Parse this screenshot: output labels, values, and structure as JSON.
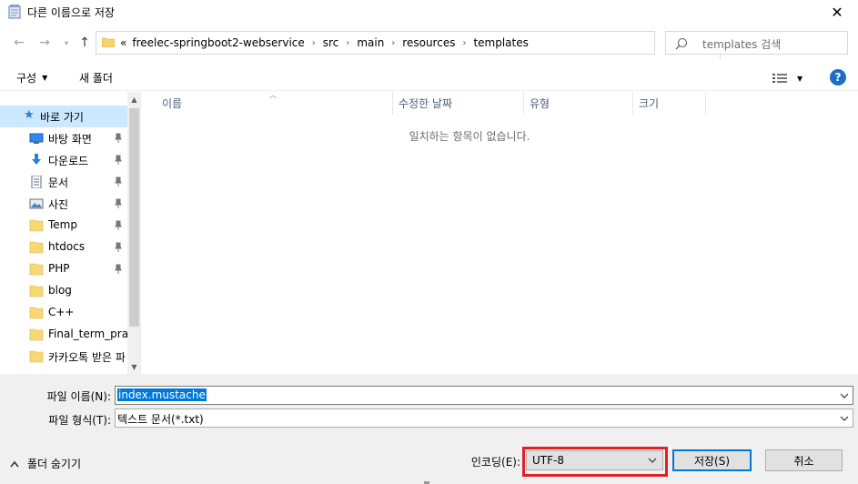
{
  "window": {
    "title": "다른 이름으로 저장"
  },
  "nav": {
    "back_icon": "arrow-left-icon",
    "forward_icon": "arrow-right-icon",
    "up_icon": "arrow-up-icon",
    "overflow": "«",
    "breadcrumbs": [
      "freelec-springboot2-webservice",
      "src",
      "main",
      "resources",
      "templates"
    ],
    "search_placeholder": "templates 검색"
  },
  "toolbar": {
    "organize": "구성",
    "new_folder": "새 폴더",
    "help": "?"
  },
  "sidebar": {
    "quick_access": "바로 가기",
    "items": [
      {
        "label": "바탕 화면",
        "icon": "desktop-icon",
        "pinned": true
      },
      {
        "label": "다운로드",
        "icon": "download-icon",
        "pinned": true
      },
      {
        "label": "문서",
        "icon": "document-icon",
        "pinned": true
      },
      {
        "label": "사진",
        "icon": "pictures-icon",
        "pinned": true
      },
      {
        "label": "Temp",
        "icon": "folder-icon",
        "pinned": true
      },
      {
        "label": "htdocs",
        "icon": "folder-icon",
        "pinned": true
      },
      {
        "label": "PHP",
        "icon": "folder-icon",
        "pinned": true
      },
      {
        "label": "blog",
        "icon": "folder-icon",
        "pinned": false
      },
      {
        "label": "C++",
        "icon": "folder-icon",
        "pinned": false
      },
      {
        "label": "Final_term_pract",
        "icon": "folder-icon",
        "pinned": false
      },
      {
        "label": "카카오톡 받은 파",
        "icon": "folder-icon",
        "pinned": false
      }
    ]
  },
  "filelist": {
    "columns": [
      "이름",
      "수정한 날짜",
      "유형",
      "크기"
    ],
    "empty_message": "일치하는 항목이 없습니다."
  },
  "form": {
    "filename_label": "파일 이름(N):",
    "filename_value": "index.mustache",
    "filetype_label": "파일 형식(T):",
    "filetype_value": "텍스트 문서(*.txt)",
    "encoding_label": "인코딩(E):",
    "encoding_value": "UTF-8",
    "save_button": "저장(S)",
    "cancel_button": "취소",
    "hide_folders": "폴더 숨기기"
  },
  "colors": {
    "selection": "#cce8ff",
    "accent": "#0078d7",
    "highlight": "#e01f26"
  }
}
